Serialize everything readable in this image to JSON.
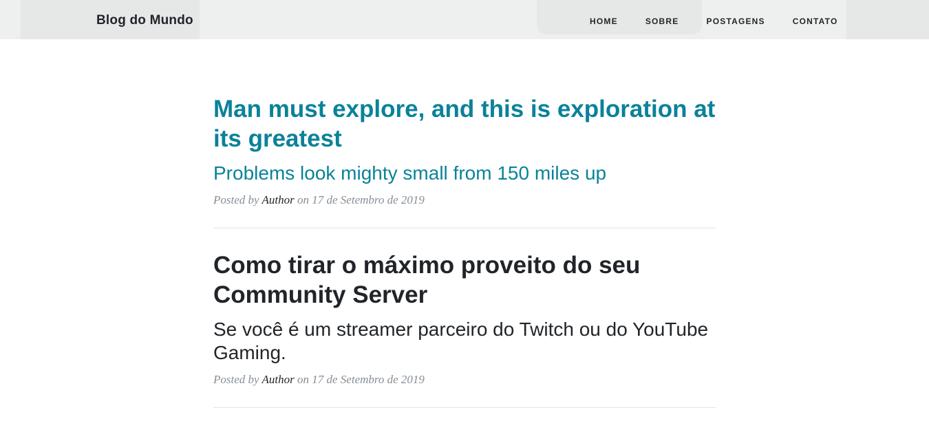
{
  "navbar": {
    "brand": "Blog do Mundo",
    "links": [
      "Home",
      "Sobre",
      "Postagens",
      "Contato"
    ]
  },
  "posts": [
    {
      "title": "Man must explore, and this is exploration at its greatest",
      "subtitle": "Problems look mighty small from 150 miles up",
      "meta_prefix": "Posted by",
      "author": "Author",
      "meta_suffix": "on 17 de Setembro de 2019"
    },
    {
      "title": "Como tirar o máximo proveito do seu Community Server",
      "subtitle": "Se você é um streamer parceiro do Twitch ou do YouTube Gaming.",
      "meta_prefix": "Posted by",
      "author": "Author",
      "meta_suffix": "on 17 de Setembro de 2019"
    }
  ],
  "colors": {
    "accent": "#0a8299",
    "text": "#212529",
    "muted": "#868e96",
    "navbar_bg": "#eef0f0"
  }
}
